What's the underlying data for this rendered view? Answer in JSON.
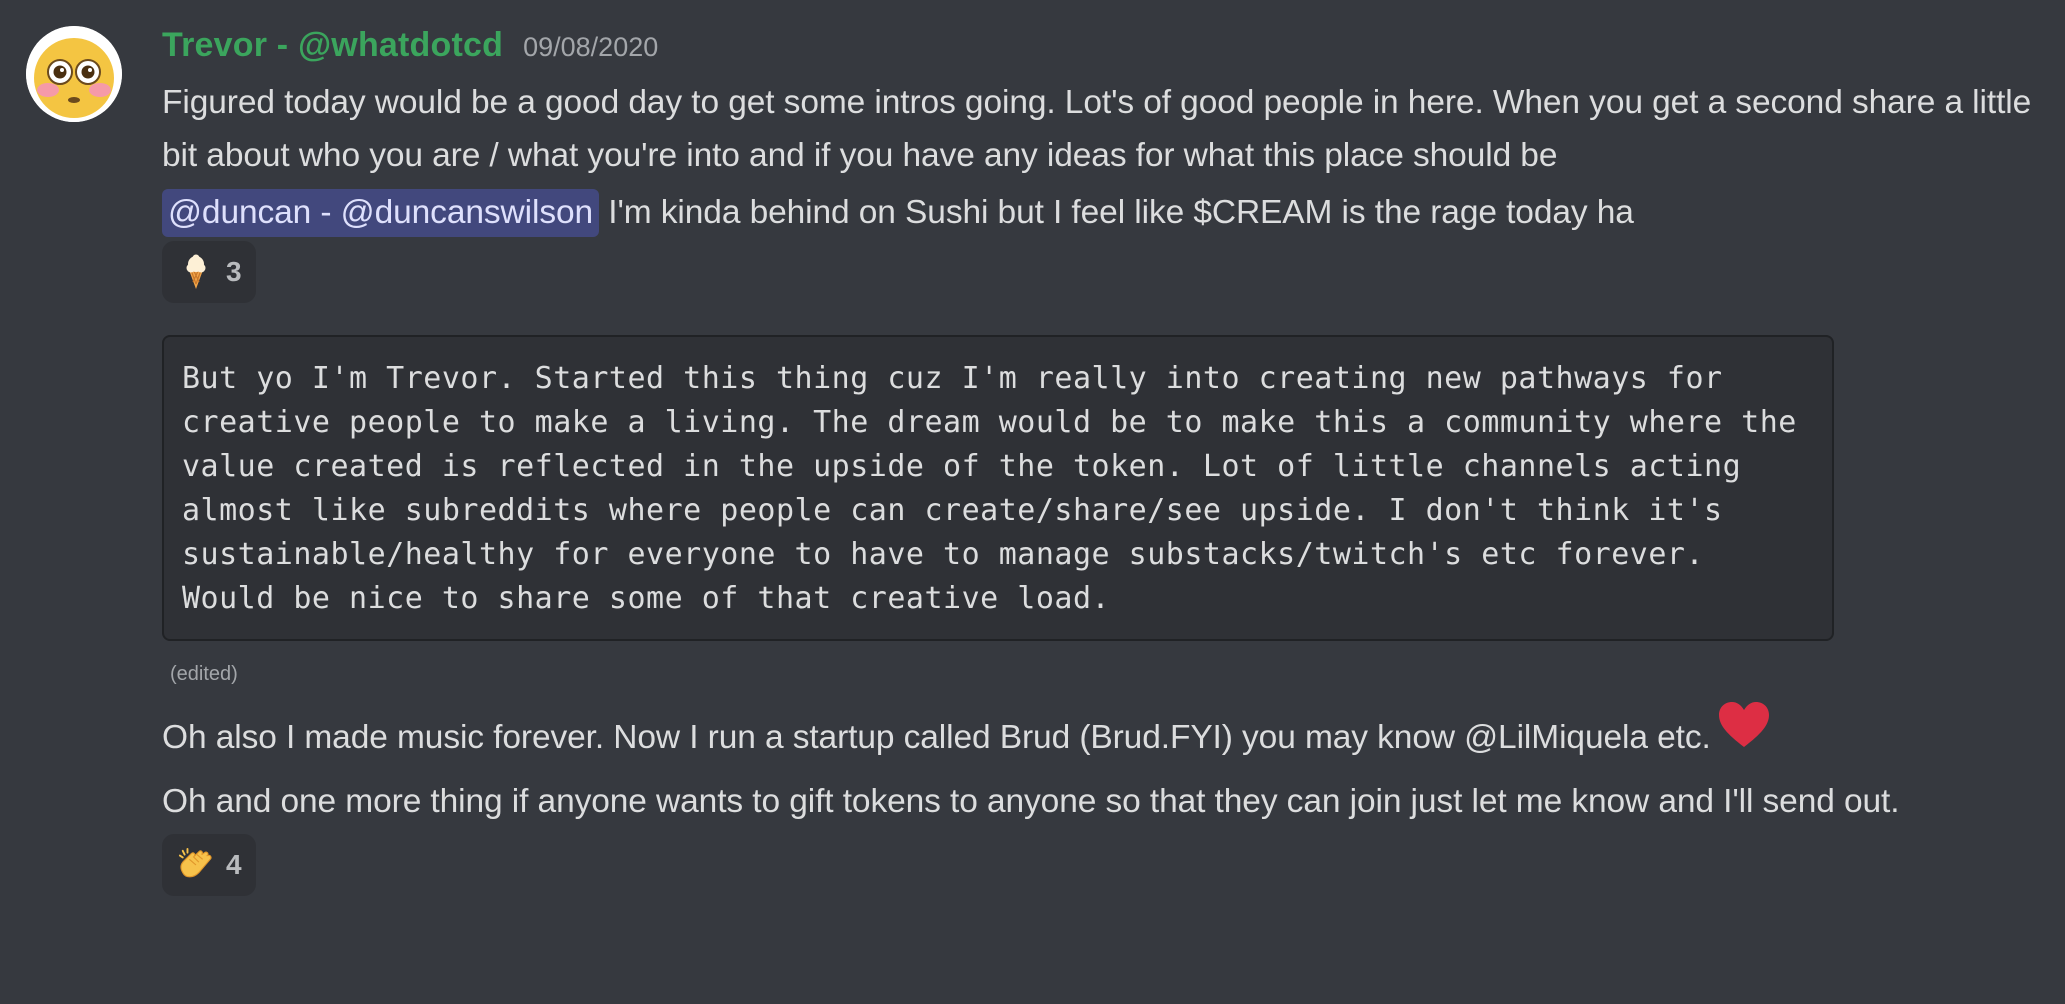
{
  "author": {
    "name": "Trevor - @whatdotcd",
    "timestamp": "09/08/2020",
    "name_color": "#3ba55d"
  },
  "messages": {
    "intro": "Figured today would be a good day to get some intros going. Lot's of good people in here. When you get a second share a little bit about who you are / what you're into and if you have any ideas for what this place should be",
    "mention": "@duncan - @duncanswilson",
    "mention_followup": " I'm kinda behind on Sushi but I feel like $CREAM is the rage today ha",
    "reaction1": {
      "emoji": "🍦",
      "icon": "ice-cream-icon",
      "count": "3"
    },
    "codeblock": "But yo I'm Trevor. Started this thing cuz I'm really into creating new pathways for creative people to make a living. The dream would be to make this a community where the value created is reflected in the upside of the token. Lot of little channels acting almost like subreddits where people can create/share/see upside. I don't think it's sustainable/healthy for everyone to have to manage substacks/twitch's etc forever. Would be nice to share some of that creative load.",
    "edited": "(edited)",
    "music": "Oh also I made music forever. Now I run a startup called Brud (Brud.FYI) you may know @LilMiquela etc.",
    "music_emoji_icon": "red-heart-icon",
    "gift": "Oh and one more thing if anyone wants to gift tokens to anyone so that they can join just let me know and I'll send out.",
    "reaction2": {
      "emoji": "👏",
      "icon": "clapping-hands-icon",
      "count": "4"
    }
  },
  "colors": {
    "background": "#36393f",
    "mention_bg": "#5865f2",
    "heart": "#dd2e44"
  }
}
